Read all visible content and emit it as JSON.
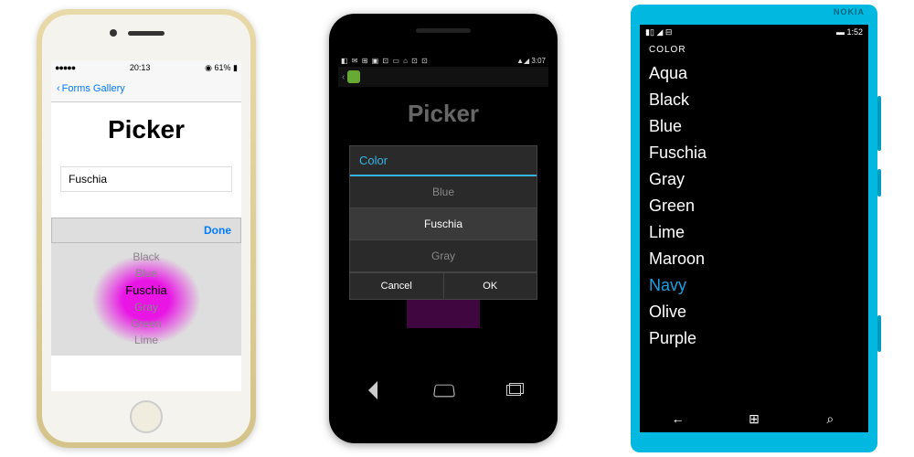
{
  "ios": {
    "status": {
      "time": "20:13",
      "battery": "61%"
    },
    "back_label": "Forms Gallery",
    "title": "Picker",
    "input_value": "Fuschia",
    "done_label": "Done",
    "wheel": [
      "Black",
      "Blue",
      "Fuschia",
      "Gray",
      "Green",
      "Lime"
    ],
    "selected": "Fuschia"
  },
  "android": {
    "status_time": "3:07",
    "title": "Picker",
    "dialog_title": "Color",
    "options": [
      "Blue",
      "Fuschia",
      "Gray"
    ],
    "selected": "Fuschia",
    "cancel_label": "Cancel",
    "ok_label": "OK",
    "swatch_color": "#a010a0"
  },
  "wp": {
    "brand": "NOKIA",
    "status_time": "1:52",
    "header": "COLOR",
    "items": [
      "Aqua",
      "Black",
      "Blue",
      "Fuschia",
      "Gray",
      "Green",
      "Lime",
      "Maroon",
      "Navy",
      "Olive",
      "Purple"
    ],
    "selected": "Navy"
  }
}
